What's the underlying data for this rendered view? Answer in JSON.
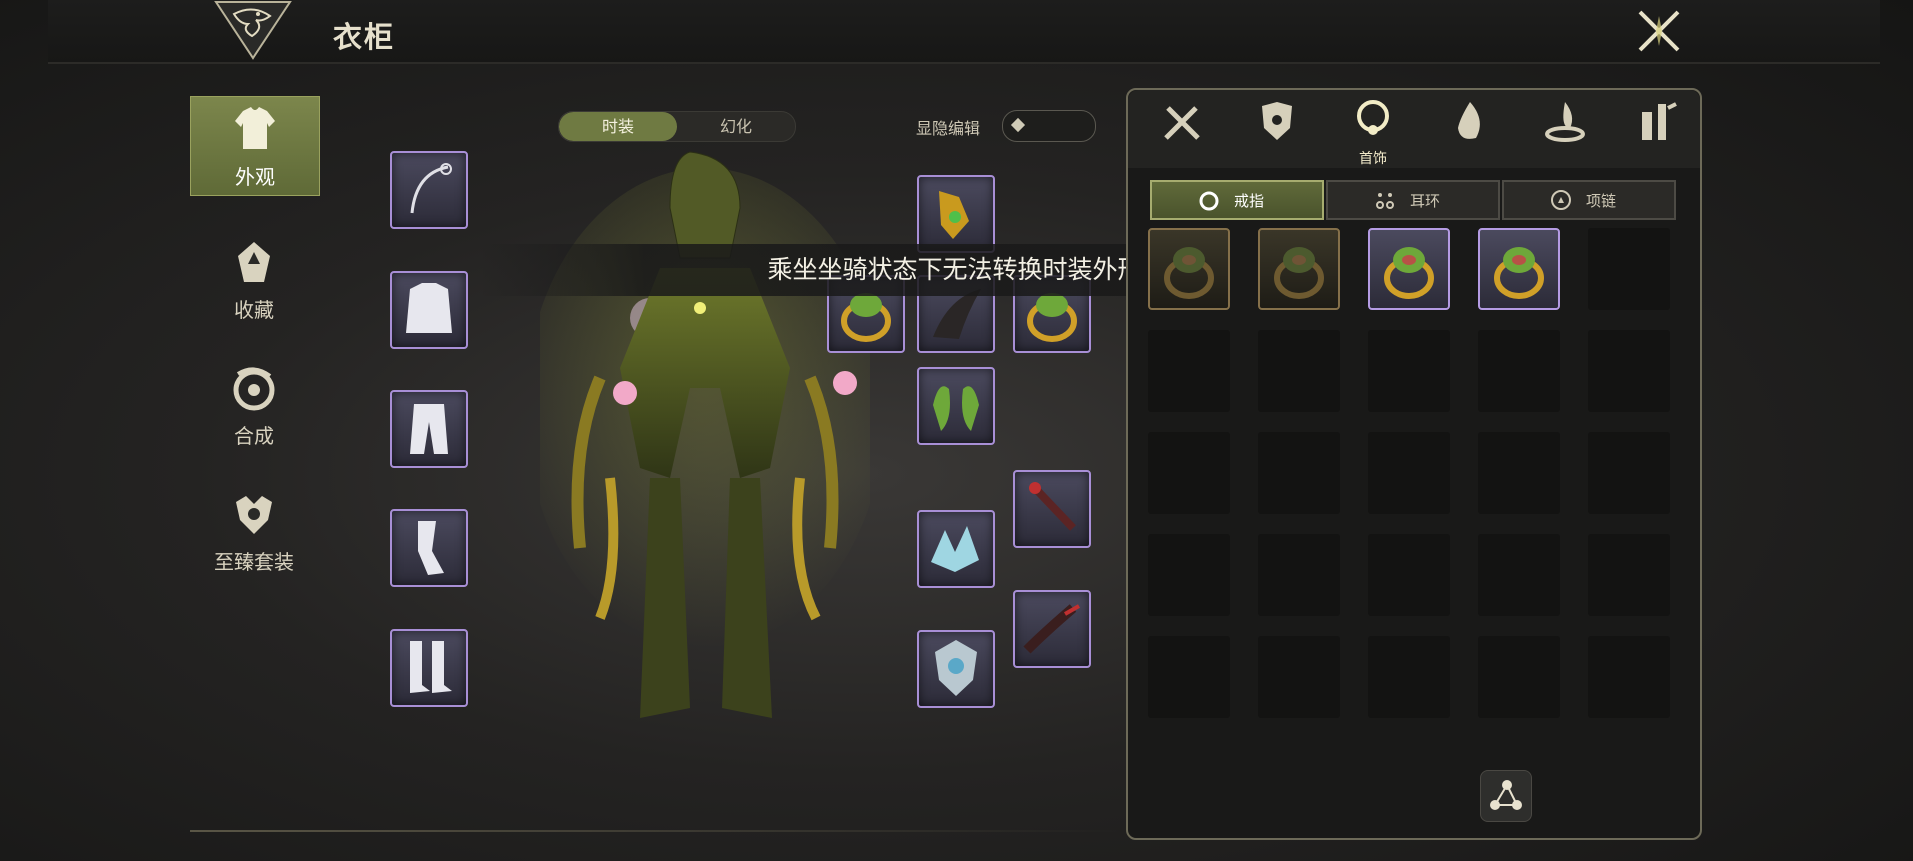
{
  "window": {
    "title": "衣柜"
  },
  "nav": [
    {
      "label": "外观",
      "icon": "outfit-icon",
      "active": true
    },
    {
      "label": "收藏",
      "icon": "collection-icon",
      "active": false
    },
    {
      "label": "合成",
      "icon": "synthesis-icon",
      "active": false
    },
    {
      "label": "至臻套装",
      "icon": "premium-set-icon",
      "active": false
    }
  ],
  "mode_toggle": {
    "options": [
      "时装",
      "幻化"
    ],
    "selected": "时装"
  },
  "show_edit": {
    "label": "显隐编辑",
    "enabled": false
  },
  "toast": {
    "message": "乘坐坐骑状态下无法转换时装外形"
  },
  "equipment_slots": {
    "left": [
      "weapon-icon",
      "top-icon",
      "pants-icon",
      "gloves-icon",
      "boots-icon"
    ],
    "right_col1": [
      "necklace-icon",
      "ring-icon",
      "hair-icon",
      "earring-icon",
      "wing-icon",
      "emblem-icon"
    ],
    "right_col2": [
      "ring-icon",
      "wand-icon",
      "tail-icon"
    ]
  },
  "panel": {
    "categories": [
      {
        "icon": "weapon-category-icon",
        "label": ""
      },
      {
        "icon": "armor-category-icon",
        "label": ""
      },
      {
        "icon": "accessory-category-icon",
        "label": "首饰",
        "active": true
      },
      {
        "icon": "flame-category-icon",
        "label": ""
      },
      {
        "icon": "aura-category-icon",
        "label": ""
      },
      {
        "icon": "misc-category-icon",
        "label": ""
      }
    ],
    "subtabs": [
      {
        "label": "戒指",
        "icon": "ring-icon",
        "active": true
      },
      {
        "label": "耳环",
        "icon": "earring-icon",
        "active": false
      },
      {
        "label": "项链",
        "icon": "necklace-icon",
        "active": false
      }
    ],
    "items": [
      {
        "state": "locked"
      },
      {
        "state": "locked"
      },
      {
        "state": "owned"
      },
      {
        "state": "owned"
      }
    ],
    "grid_rows": 5,
    "grid_cols": 5
  },
  "colors": {
    "accent": "#6f7a42",
    "rarity_purple": "#b59ce4",
    "locked_gold": "#85704a"
  }
}
